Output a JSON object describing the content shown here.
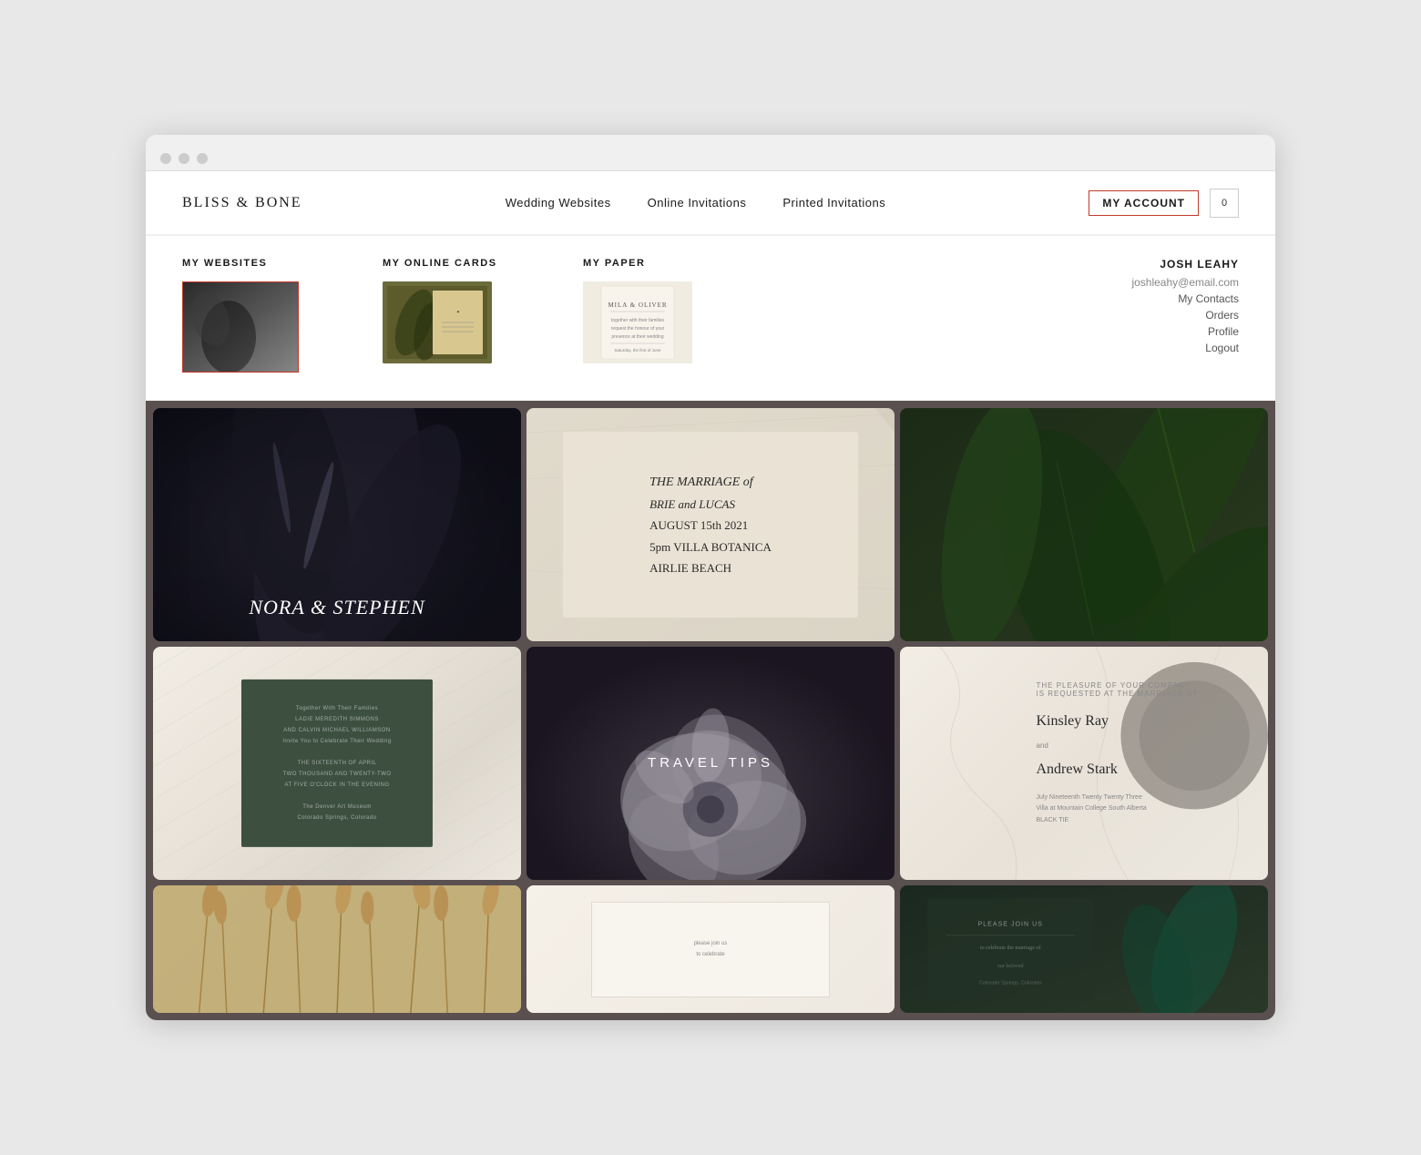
{
  "browser": {
    "dots": [
      "dot1",
      "dot2",
      "dot3"
    ]
  },
  "navbar": {
    "logo": "BLISS & BONE",
    "links": [
      {
        "label": "Wedding Websites",
        "id": "wedding-websites"
      },
      {
        "label": "Online Invitations",
        "id": "online-invitations"
      },
      {
        "label": "Printed Invitations",
        "id": "printed-invitations"
      }
    ],
    "my_account_label": "MY ACCOUNT",
    "cart_count": "0"
  },
  "dropdown": {
    "my_websites_label": "MY WEBSITES",
    "my_online_cards_label": "MY ONLINE CARDS",
    "my_paper_label": "MY PAPER",
    "account": {
      "name": "JOSH LEAHY",
      "email": "joshleahy@email.com",
      "links": [
        "My Contacts",
        "Orders",
        "Profile",
        "Logout"
      ]
    },
    "paper_card_text": "MILA & OLIVER"
  },
  "hero": {
    "tile1": {
      "names": "NORA & STEPHEN",
      "type": "dark_leaf"
    },
    "tile2": {
      "title_line1": "THE MARRIAGE of",
      "title_line2": "BRIE and LUCAS",
      "title_line3": "AUGUST 15th 2021",
      "title_line4": "5pm VILLA BOTANICA",
      "title_line5": "AIRLIE BEACH",
      "type": "cream"
    },
    "tile3": {
      "type": "green_plants"
    },
    "tile4": {
      "type": "green_invitation",
      "body_text": "Together With Their Families LADIE MEREDITH SIMMONS AND CALVIN MICHAEL WILLIAMSON Invite You to Celebrate Their Wedding THE SIXTEENTH OF APRIL TWO THOUSAND AND TWENTY-TWO AT FIVE O'CLOCK IN THE EVENING The Denver Art Museum Colorado Springs, Colorado"
    },
    "tile5": {
      "label": "TRAVEL TIPS",
      "type": "dark_flower"
    },
    "tile6": {
      "names1": "Kinsley Ray",
      "names2": "Andrew Stark",
      "date": "July Nineteenth Twenty Twenty Three",
      "venue": "Villa at Mountain College South Alberta",
      "note": "BLACK TIE",
      "type": "marble"
    },
    "bottom_tiles": {
      "tile7": {
        "type": "grass"
      },
      "tile8": {
        "type": "white_cream"
      },
      "tile9": {
        "type": "dark_green_card"
      }
    }
  }
}
